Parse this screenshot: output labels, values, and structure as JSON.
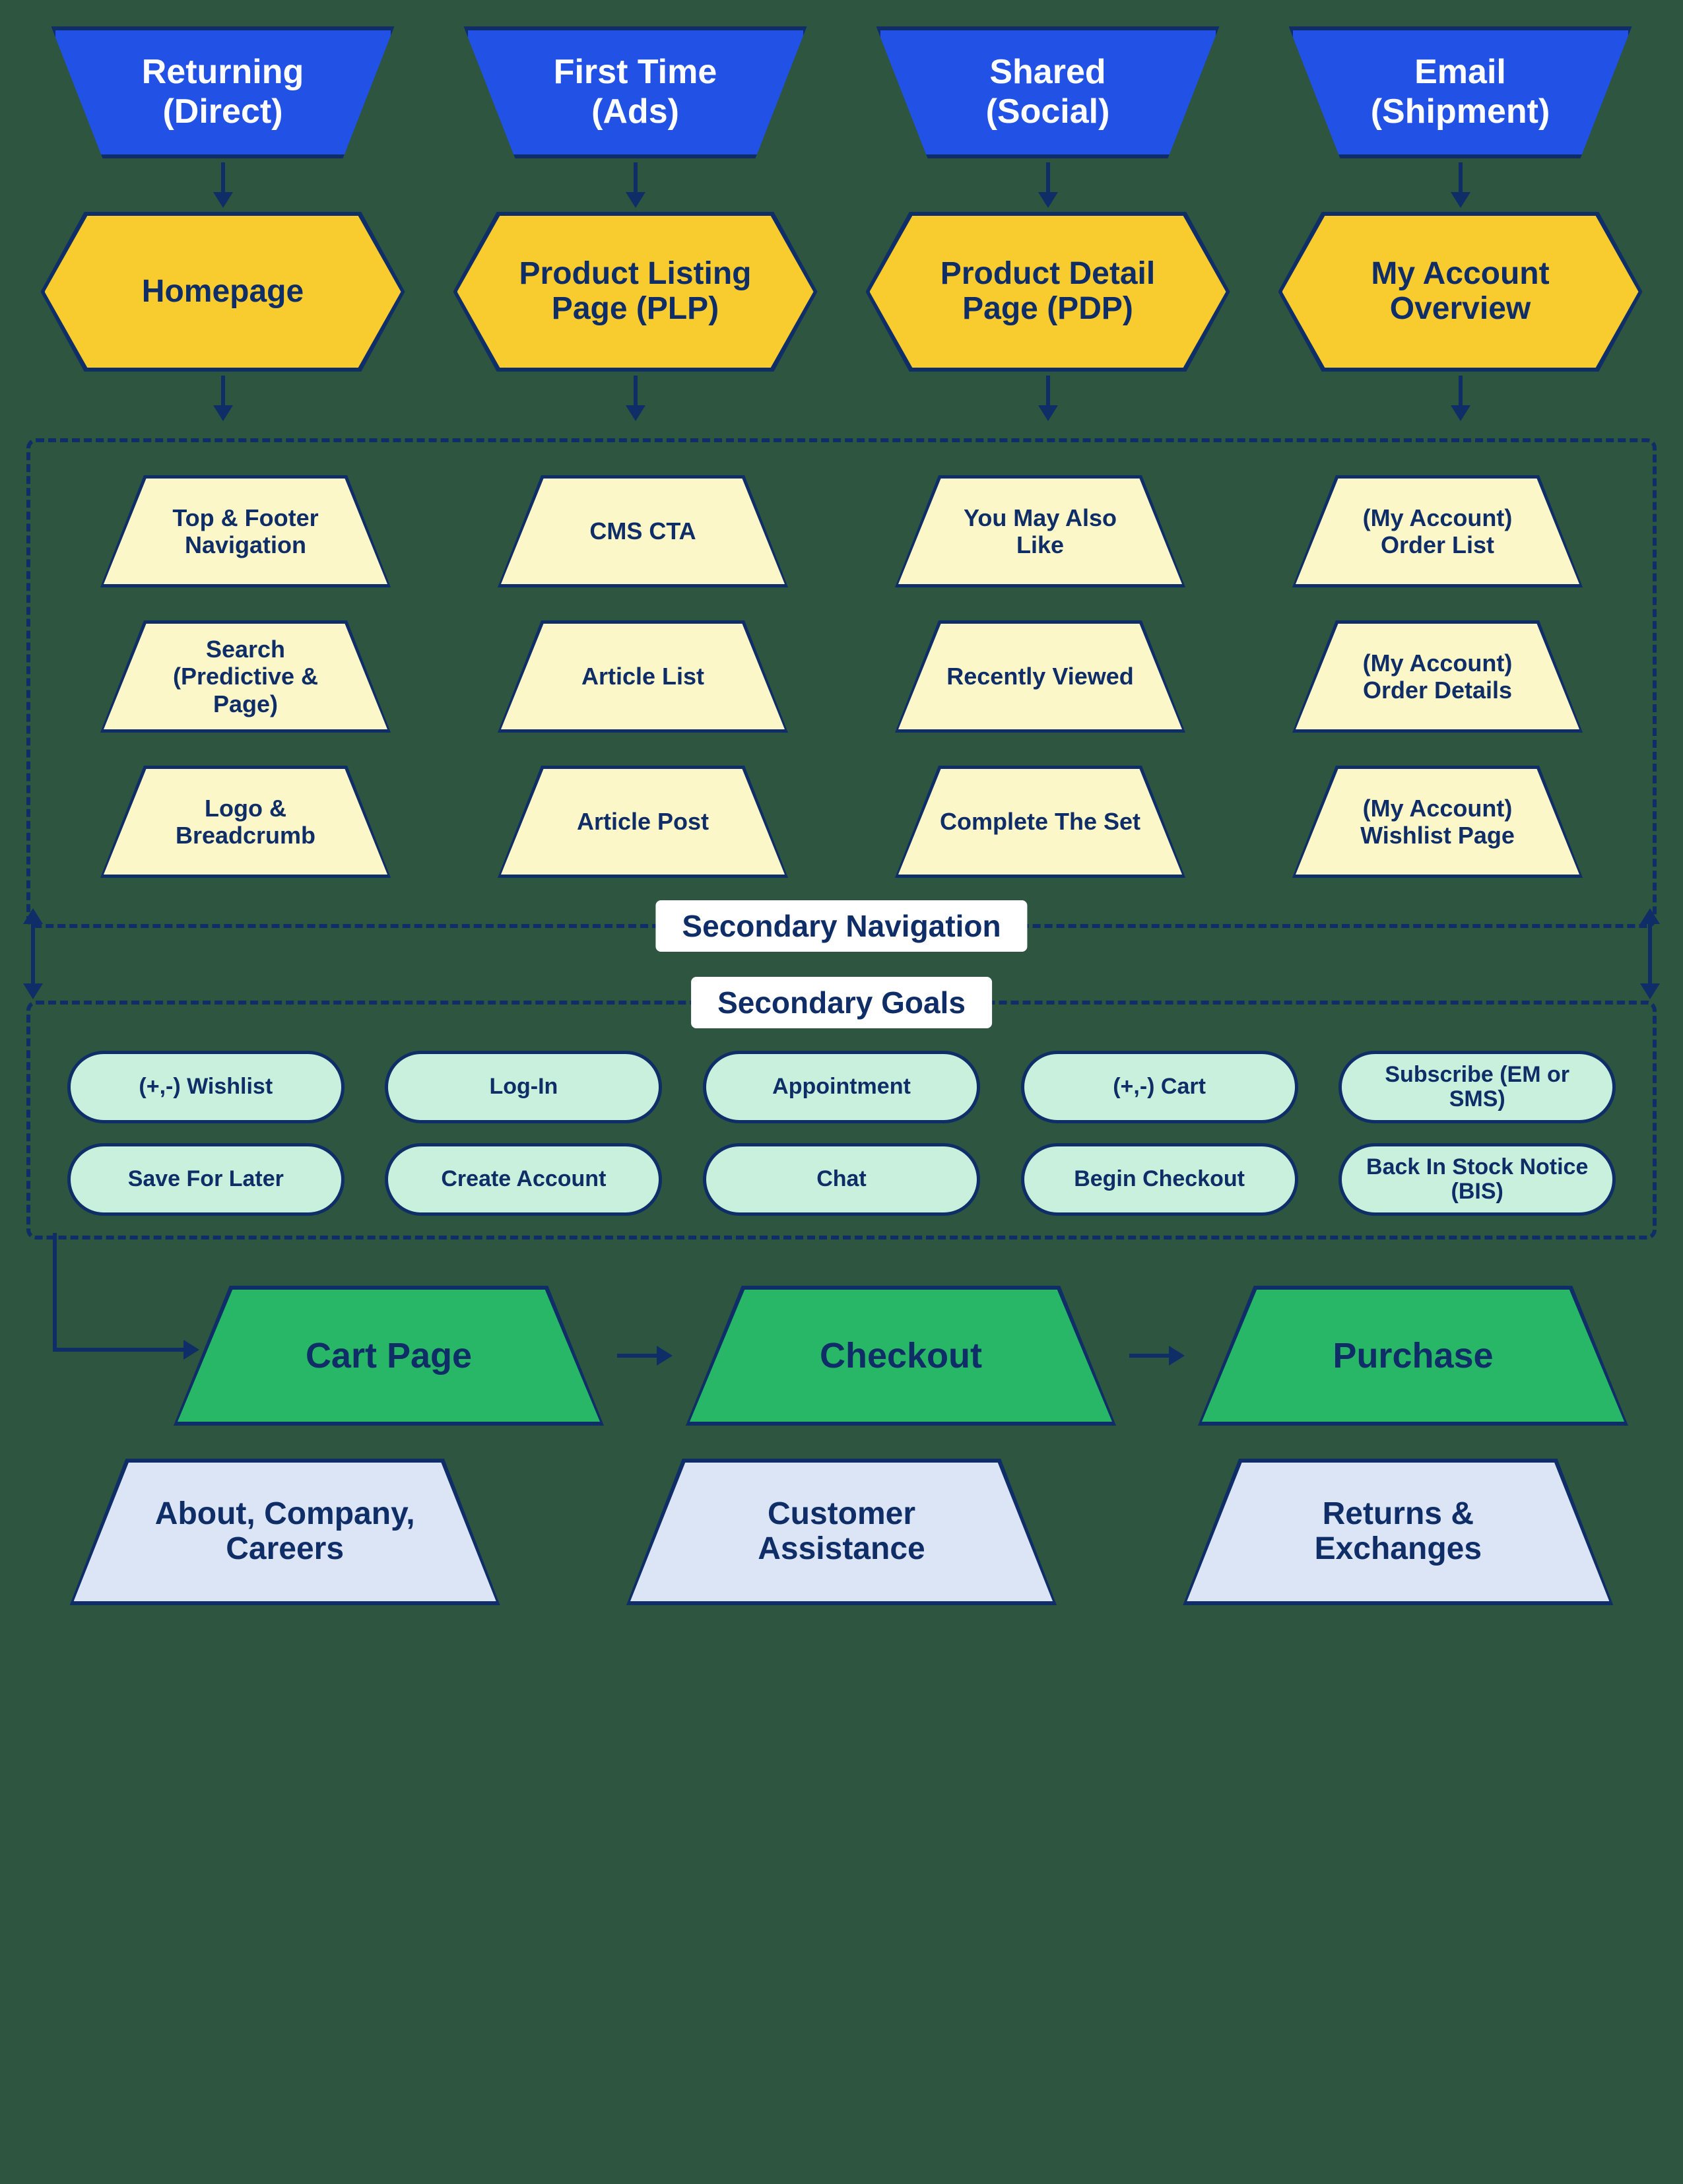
{
  "entry": [
    {
      "line1": "Returning",
      "line2": "(Direct)"
    },
    {
      "line1": "First Time",
      "line2": "(Ads)"
    },
    {
      "line1": "Shared",
      "line2": "(Social)"
    },
    {
      "line1": "Email",
      "line2": "(Shipment)"
    }
  ],
  "landing": [
    "Homepage",
    "Product Listing Page (PLP)",
    "Product Detail Page (PDP)",
    "My Account Overview"
  ],
  "secondary_nav": {
    "label": "Secondary Navigation",
    "items": [
      "Top & Footer Navigation",
      "CMS CTA",
      "You May Also Like",
      "(My Account) Order List",
      "Search (Predictive & Page)",
      "Article List",
      "Recently Viewed",
      "(My Account) Order Details",
      "Logo & Breadcrumb",
      "Article Post",
      "Complete The Set",
      "(My Account) Wishlist Page"
    ]
  },
  "secondary_goals": {
    "label": "Secondary Goals",
    "items": [
      "(+,-) Wishlist",
      "Log-In",
      "Appointment",
      "(+,-) Cart",
      "Subscribe (EM or SMS)",
      "Save For Later",
      "Create Account",
      "Chat",
      "Begin Checkout",
      "Back In Stock Notice (BIS)"
    ]
  },
  "conversion": [
    "Cart Page",
    "Checkout",
    "Purchase"
  ],
  "info": [
    "About, Company, Careers",
    "Customer Assistance",
    "Returns & Exchanges"
  ]
}
